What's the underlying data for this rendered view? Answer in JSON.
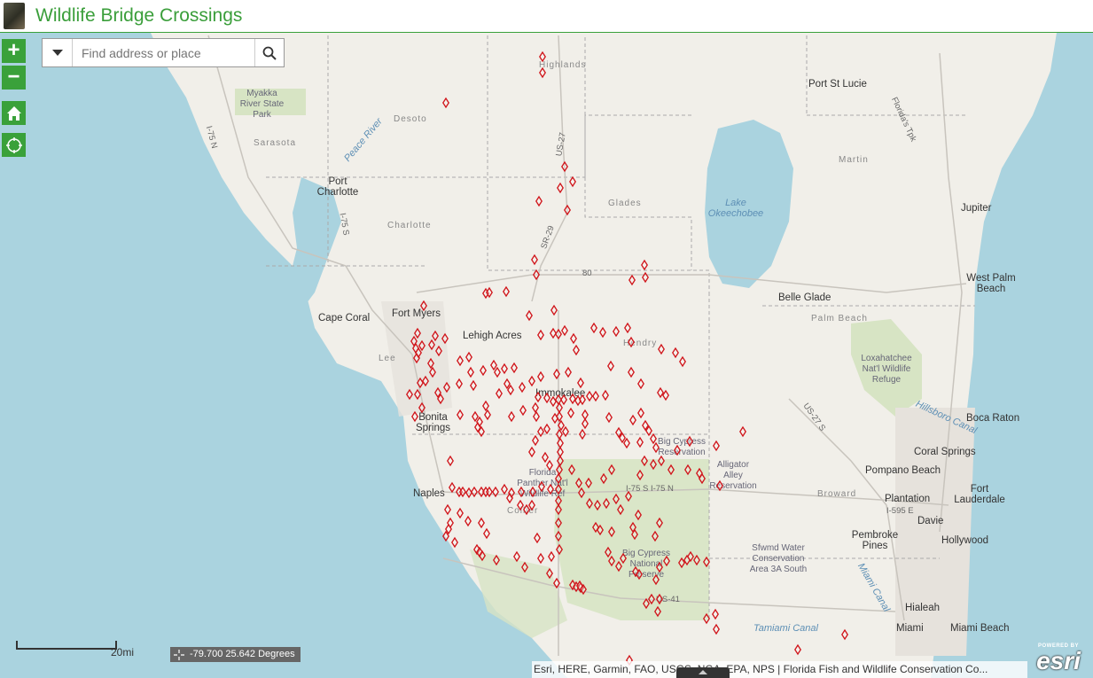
{
  "app": {
    "title": "Wildlife Bridge Crossings"
  },
  "search": {
    "placeholder": "Find address or place"
  },
  "controls": {
    "zoom_in": "+",
    "zoom_out": "−"
  },
  "scale": {
    "label": "20mi"
  },
  "coordinates": {
    "text": "-79.700 25.642 Degrees"
  },
  "attribution": {
    "text": "Esri, HERE, Garmin, FAO, USGS, NGA, EPA, NPS | Florida Fish and Wildlife Conservation Co..."
  },
  "esri_logo": {
    "powered": "POWERED BY",
    "brand": "esri"
  },
  "map_labels": {
    "highlands": "Highlands",
    "port_st_lucie": "Port St Lucie",
    "myakka": "Myakka River State Park",
    "desoto": "Desoto",
    "sarasota": "Sarasota",
    "peace_river": "Peace River",
    "port_charlotte": "Port Charlotte",
    "martin": "Martin",
    "glades": "Glades",
    "lake_okeechobee": "Lake Okeechobee",
    "jupiter": "Jupiter",
    "charlotte": "Charlotte",
    "west_palm_beach": "West Palm Beach",
    "belle_glade": "Belle Glade",
    "palm_beach": "Palm Beach",
    "cape_coral": "Cape Coral",
    "fort_myers": "Fort Myers",
    "lehigh_acres": "Lehigh Acres",
    "hendry": "Hendry",
    "lee": "Lee",
    "loxahatchee": "Loxahatchee Nat'l Wildlife Refuge",
    "immokalee": "Immokalee",
    "hillsboro_canal": "Hillsboro Canal",
    "boca_raton": "Boca Raton",
    "bonita_springs": "Bonita Springs",
    "big_cypress_res": "Big Cypress Reservation",
    "coral_springs": "Coral Springs",
    "alligator_alley": "Alligator Alley Reservation",
    "pompano_beach": "Pompano Beach",
    "florida_panther": "Florida Panther Nat'l Wildlife Ref",
    "broward": "Broward",
    "plantation": "Plantation",
    "fort_lauderdale": "Fort Lauderdale",
    "naples": "Naples",
    "collier": "Collier",
    "davie": "Davie",
    "pembroke_pines": "Pembroke Pines",
    "hollywood": "Hollywood",
    "sfwmd": "Sfwmd Water Conservation Area 3A South",
    "big_cypress_np": "Big Cypress National Preserve",
    "miami_canal": "Miami Canal",
    "hialeah": "Hialeah",
    "tamiami_canal": "Tamiami Canal",
    "miami": "Miami",
    "miami_beach": "Miami Beach",
    "i75_n": "I-75 N",
    "i75_s_label": "I-75 S",
    "us27": "US-27",
    "sr29": "SR-29",
    "r80": "80",
    "i75_s_i75_n": "I-75 S  I-75 N",
    "i595": "I-595 E",
    "us41": "US-41",
    "floridas_tpk": "Florida's Tpk",
    "us27_e": "US-27 S"
  },
  "colors": {
    "water": "#aad3df",
    "land": "#f1efe9",
    "park": "#d7e4c4",
    "urban": "#e6e2dc",
    "marker": "#d0141a",
    "header_accent": "#3aa13a"
  }
}
